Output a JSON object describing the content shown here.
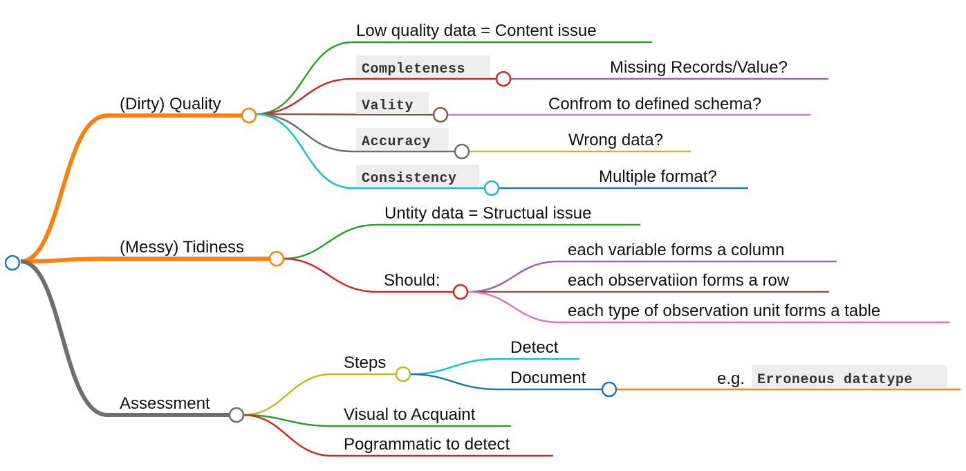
{
  "mindmap": {
    "colors": {
      "orange": "#ff7f0e",
      "gray": "#6e6e6e",
      "green": "#2ca02c",
      "red": "#d62728",
      "brown": "#8c564b",
      "cyan": "#17becf",
      "blue": "#1f77b4",
      "purple": "#9467bd",
      "pink": "#e377c2",
      "olive": "#bcbd22"
    },
    "quality": {
      "label": "(Dirty) Quality",
      "content_issue": "Low quality data = Content issue",
      "completeness": {
        "code": "Completeness",
        "question": "Missing Records/Value?"
      },
      "vality": {
        "code": "Vality",
        "question": "Confrom to defined schema?"
      },
      "accuracy": {
        "code": "Accuracy",
        "question": "Wrong data?"
      },
      "consistency": {
        "code": "Consistency",
        "question": "Multiple format?"
      }
    },
    "tidiness": {
      "label": "(Messy) Tidiness",
      "structural_issue": "Untity data = Structual issue",
      "should": {
        "label": "Should:",
        "rules": [
          "each variable forms a column",
          "each observatiion forms a row",
          "each type of observation unit forms a table"
        ]
      }
    },
    "assessment": {
      "label": "Assessment",
      "steps": {
        "label": "Steps",
        "detect": "Detect",
        "document": {
          "label": "Document",
          "example_prefix": "e.g.",
          "example_code": "Erroneous datatype"
        }
      },
      "visual": "Visual to Acquaint",
      "programmatic": "Pogrammatic to detect"
    }
  }
}
